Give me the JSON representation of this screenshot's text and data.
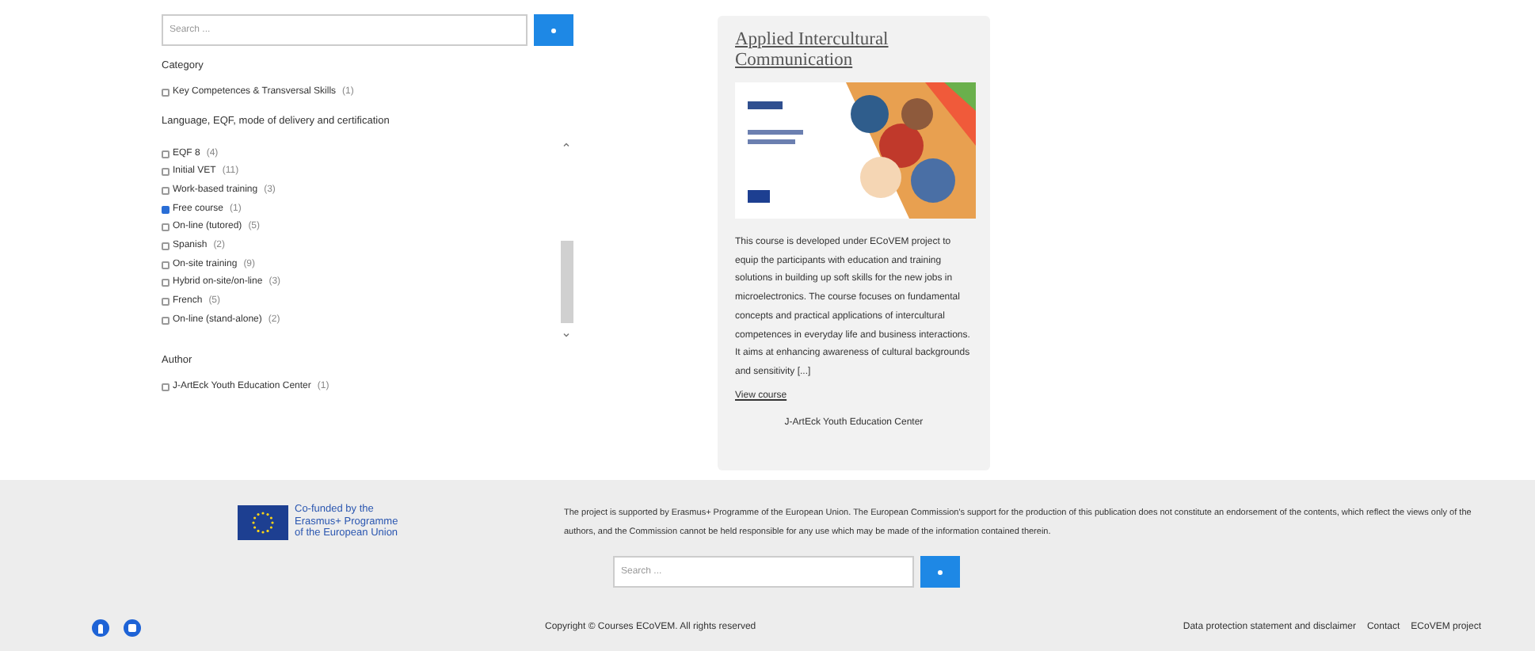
{
  "search": {
    "placeholder": "Search ..."
  },
  "filters": [
    {
      "title": "Category",
      "scroll": false,
      "options": [
        {
          "label": "Key Competences & Transversal Skills",
          "count": "(1)",
          "checked": false
        }
      ]
    },
    {
      "title": "Language, EQF, mode of delivery and certification",
      "scroll": true,
      "options": [
        {
          "label": "EQF 8",
          "count": "(4)",
          "checked": false
        },
        {
          "label": "Initial VET",
          "count": "(11)",
          "checked": false
        },
        {
          "label": "Work-based training",
          "count": "(3)",
          "checked": false
        },
        {
          "label": "Free course",
          "count": "(1)",
          "checked": true
        },
        {
          "label": "On-line (tutored)",
          "count": "(5)",
          "checked": false
        },
        {
          "label": "Spanish",
          "count": "(2)",
          "checked": false
        },
        {
          "label": "On-site training",
          "count": "(9)",
          "checked": false
        },
        {
          "label": "Hybrid on-site/on-line",
          "count": "(3)",
          "checked": false
        },
        {
          "label": "French",
          "count": "(5)",
          "checked": false
        },
        {
          "label": "On-line (stand-alone)",
          "count": "(2)",
          "checked": false
        }
      ]
    },
    {
      "title": "Author",
      "scroll": false,
      "options": [
        {
          "label": "J-ArtEck Youth Education Center",
          "count": "(1)",
          "checked": false
        }
      ]
    }
  ],
  "course": {
    "title": "Applied Intercultural Communication",
    "description": "This course is developed under ECoVEM project to equip the participants with education and training solutions in building up soft skills for the new jobs in microelectronics. The course focuses on fundamental concepts and practical applications of intercultural competences in everyday life and business interactions. It aims at enhancing awareness of cultural backgrounds and sensitivity [...]",
    "link": "View course",
    "author": "J-ArtEck Youth Education Center"
  },
  "footer": {
    "eu_text": [
      "Co-funded by the",
      "Erasmus+ Programme",
      "of the European Union"
    ],
    "disclaimer": "The project is supported by Erasmus+ Programme of the European Union. The European Commission's support for the production of this publication does not constitute an endorsement of the contents, which reflect the views only of the authors, and the Commission cannot be held responsible for any use which may be made of the information contained therein.",
    "search": {
      "placeholder": "Search ..."
    },
    "copyright": "Copyright © Courses ECoVEM. All rights reserved",
    "links": [
      "Data protection statement and disclaimer",
      "Contact",
      "ECoVEM project"
    ]
  }
}
